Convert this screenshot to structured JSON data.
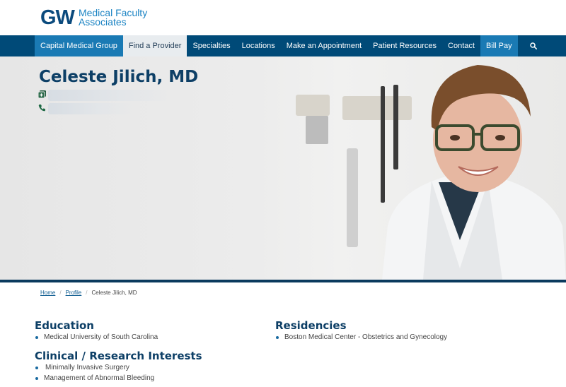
{
  "brand": {
    "mark": "GW",
    "line1": "Medical Faculty",
    "line2": "Associates"
  },
  "nav": {
    "items": [
      {
        "label": "Capital Medical Group"
      },
      {
        "label": "Find a Provider"
      },
      {
        "label": "Specialties"
      },
      {
        "label": "Locations"
      },
      {
        "label": "Make an Appointment"
      },
      {
        "label": "Patient Resources"
      },
      {
        "label": "Contact"
      },
      {
        "label": "Bill Pay"
      }
    ],
    "search_icon": "search-icon"
  },
  "hero": {
    "name": "Celeste Jilich, MD",
    "icons": [
      "add-icon",
      "phone-icon"
    ]
  },
  "breadcrumb": {
    "home": "Home",
    "profile": "Profile",
    "current": "Celeste Jilich, MD"
  },
  "education": {
    "title": "Education",
    "items": [
      "Medical University of South Carolina"
    ]
  },
  "residencies": {
    "title": "Residencies",
    "items": [
      "Boston Medical Center - Obstetrics and Gynecology"
    ]
  },
  "interests": {
    "title": "Clinical / Research Interests",
    "items": [
      "Minimally Invasive Surgery",
      "Management of Abnormal Bleeding"
    ]
  },
  "colors": {
    "nav_bg": "#004a78",
    "nav_active": "#1a7ab4",
    "heading": "#0d3f66",
    "link": "#0b5a8f"
  }
}
